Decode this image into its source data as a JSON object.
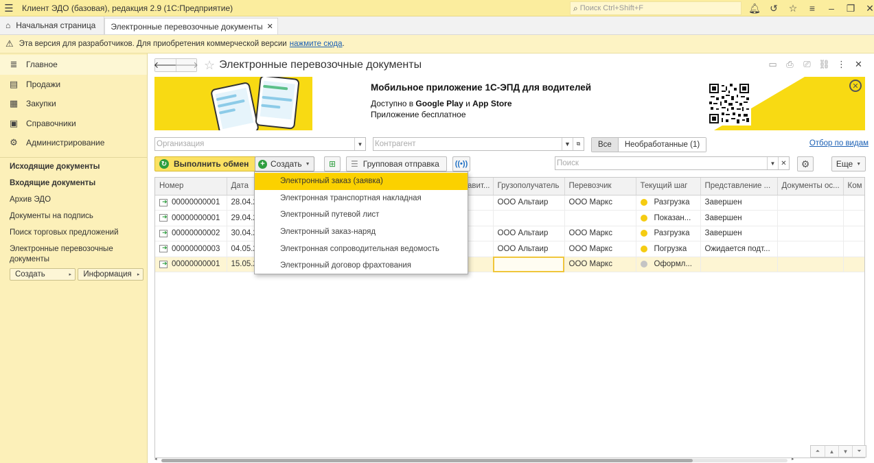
{
  "window": {
    "title": "Клиент ЭДО (базовая), редакция 2.9  (1С:Предприятие)",
    "search_placeholder": "Поиск Ctrl+Shift+F"
  },
  "tabs": {
    "home": "Начальная страница",
    "active": "Электронные перевозочные документы",
    "close_glyph": "✕"
  },
  "warning": {
    "text": "Эта версия для разработчиков. Для приобретения коммерческой версии",
    "link": "нажмите сюда",
    "suffix": "."
  },
  "sidebar": {
    "sections": [
      {
        "label": "Главное",
        "icon": "menu-lines-icon"
      },
      {
        "label": "Продажи",
        "icon": "briefcase-icon"
      },
      {
        "label": "Закупки",
        "icon": "cart-icon"
      },
      {
        "label": "Справочники",
        "icon": "book-icon"
      },
      {
        "label": "Администрирование",
        "icon": "gear-icon"
      }
    ],
    "links": [
      {
        "label": "Исходящие документы",
        "bold": true
      },
      {
        "label": "Входящие документы",
        "bold": true
      },
      {
        "label": "Архив ЭДО",
        "bold": false
      },
      {
        "label": "Документы на подпись",
        "bold": false
      },
      {
        "label": "Поиск торговых предложений",
        "bold": false
      },
      {
        "label": "Электронные перевозочные документы",
        "bold": false
      }
    ],
    "buttons": [
      "Создать",
      "Информация"
    ]
  },
  "form": {
    "title": "Электронные перевозочные документы"
  },
  "banner": {
    "title": "Мобильное приложение 1С-ЭПД для водителей",
    "line1_prefix": "Доступно в",
    "line1_store1": "Google Play",
    "line1_and": "и",
    "line1_store2": "App Store",
    "line2": "Приложение бесплатное"
  },
  "filters": {
    "organization_placeholder": "Организация",
    "counterparty_placeholder": "Контрагент",
    "seg_all": "Все",
    "seg_unprocessed": "Необработанные (1)",
    "views_link": "Отбор по видам"
  },
  "commands": {
    "exchange": "Выполнить обмен",
    "create": "Создать",
    "group_send": "Групповая отправка",
    "search_placeholder": "Поиск",
    "more": "Еще"
  },
  "table": {
    "columns": [
      "Номер",
      "Дата",
      "",
      "",
      "Отправит...",
      "Грузополучатель",
      "Перевозчик",
      "Текущий шаг",
      "Представление ...",
      "Документы ос...",
      "Ком"
    ],
    "rows": [
      {
        "number": "00000000001",
        "date": "28.04.2",
        "consignee": "ООО Альтаир",
        "carrier": "ООО Маркс",
        "step": "Разгрузка",
        "step_color": "yellow",
        "state": "Завершен"
      },
      {
        "number": "00000000001",
        "date": "29.04.2",
        "consignee": "",
        "carrier": "",
        "step": "Показан...",
        "step_color": "yellow",
        "state": "Завершен"
      },
      {
        "number": "00000000002",
        "date": "30.04.2",
        "consignee": "ООО Альтаир",
        "carrier": "ООО Маркс",
        "step": "Разгрузка",
        "step_color": "yellow",
        "state": "Завершен"
      },
      {
        "number": "00000000003",
        "date": "04.05.2",
        "consignee": "ООО Альтаир",
        "carrier": "ООО Маркс",
        "step": "Погрузка",
        "step_color": "yellow",
        "state": "Ожидается подт..."
      },
      {
        "number": "00000000001",
        "date": "15.05.2",
        "consignee": "",
        "carrier": "ООО Маркс",
        "step": "Оформл...",
        "step_color": "grey",
        "state": ""
      }
    ]
  },
  "dropdown": {
    "items": [
      "Электронный заказ (заявка)",
      "Электронная транспортная накладная",
      "Электронный путевой лист",
      "Электронный заказ-наряд",
      "Электронная сопроводительная ведомость",
      "Электронный договор фрахтования"
    ],
    "highlighted_index": 0
  },
  "colors": {
    "accent_yellow": "#fbd100",
    "sidebar_bg": "#fcf0b9",
    "link_blue": "#1a5fb4",
    "success_green": "#2e9e3f"
  }
}
